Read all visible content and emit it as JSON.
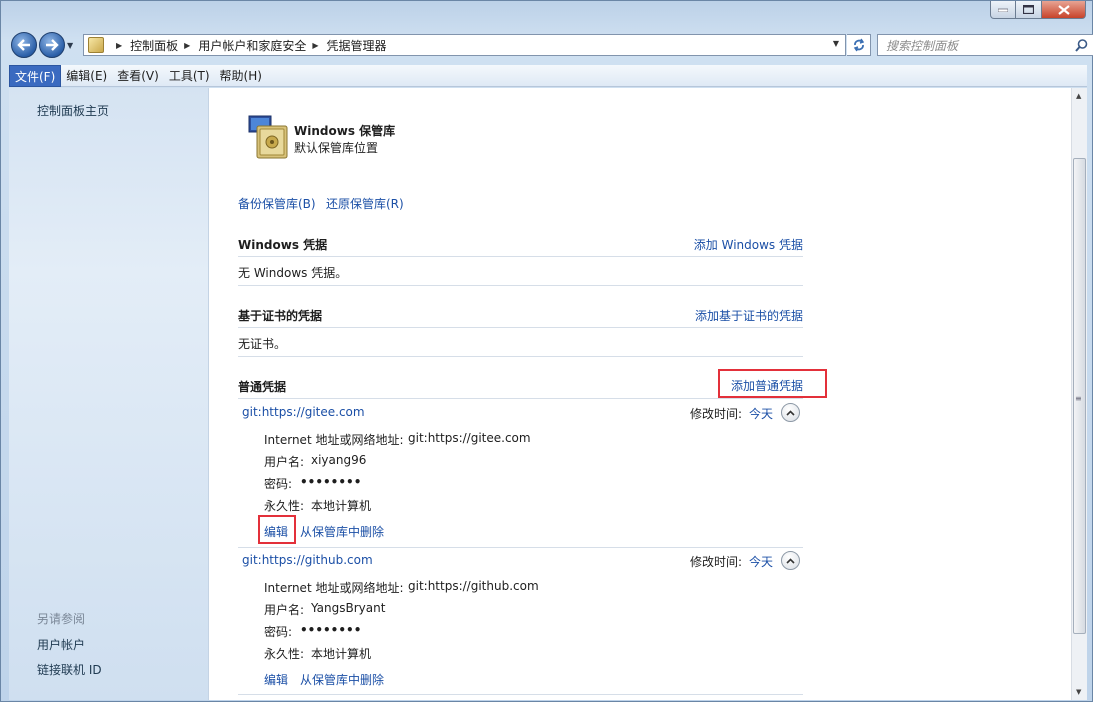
{
  "window": {
    "breadcrumbs": [
      "控制面板",
      "用户帐户和家庭安全",
      "凭据管理器"
    ],
    "search_placeholder": "搜索控制面板"
  },
  "menu": [
    "文件(F)",
    "编辑(E)",
    "查看(V)",
    "工具(T)",
    "帮助(H)"
  ],
  "sidebar": {
    "home": "控制面板主页",
    "see_also_heading": "另请参阅",
    "see_also": [
      "用户帐户",
      "链接联机 ID"
    ]
  },
  "vault": {
    "title": "Windows 保管库",
    "subtitle": "默认保管库位置",
    "backup": "备份保管库(B)",
    "restore": "还原保管库(R)"
  },
  "sections": {
    "windows": {
      "title": "Windows 凭据",
      "add": "添加 Windows 凭据",
      "empty": "无 Windows 凭据。"
    },
    "cert": {
      "title": "基于证书的凭据",
      "add": "添加基于证书的凭据",
      "empty": "无证书。"
    },
    "generic": {
      "title": "普通凭据",
      "add": "添加普通凭据"
    }
  },
  "credentials": [
    {
      "name": "git:https://gitee.com",
      "modified_label": "修改时间:",
      "modified": "今天",
      "address_label": "Internet 地址或网络地址:",
      "address": "git:https://gitee.com",
      "user_label": "用户名:",
      "user": "xiyang96",
      "password_label": "密码:",
      "password": "••••••••",
      "persist_label": "永久性:",
      "persist": "本地计算机",
      "edit": "编辑",
      "remove": "从保管库中删除"
    },
    {
      "name": "git:https://github.com",
      "modified_label": "修改时间:",
      "modified": "今天",
      "address_label": "Internet 地址或网络地址:",
      "address": "git:https://github.com",
      "user_label": "用户名:",
      "user": "YangsBryant",
      "password_label": "密码:",
      "password": "••••••••",
      "persist_label": "永久性:",
      "persist": "本地计算机",
      "edit": "编辑",
      "remove": "从保管库中删除"
    }
  ],
  "colors": {
    "link": "#1b4fa6",
    "highlight_box": "#e3303a",
    "menu_active": "#3a6ac0"
  }
}
